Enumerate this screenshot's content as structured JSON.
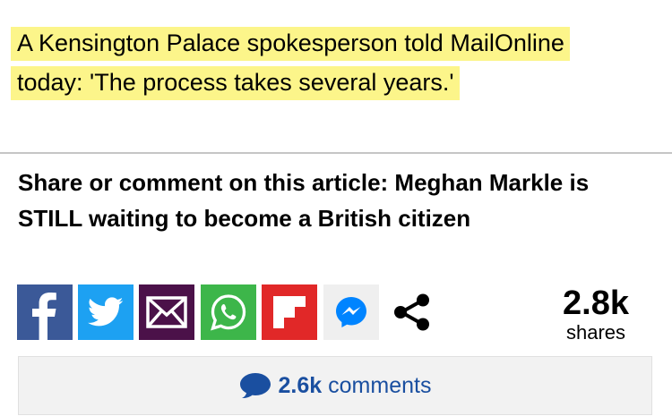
{
  "article": {
    "quote": "A Kensington Palace spokesperson told MailOnline today: 'The process takes several years.'",
    "share_title": "Share or comment on this article: Meghan Markle is STILL waiting to become a British citizen"
  },
  "share": {
    "buttons": [
      {
        "name": "facebook",
        "icon": "facebook-icon",
        "color": "#3b5998"
      },
      {
        "name": "twitter",
        "icon": "twitter-icon",
        "color": "#1da1f2"
      },
      {
        "name": "email",
        "icon": "email-icon",
        "color": "#4b1149"
      },
      {
        "name": "whatsapp",
        "icon": "whatsapp-icon",
        "color": "#3db64a"
      },
      {
        "name": "flipboard",
        "icon": "flipboard-icon",
        "color": "#e12828"
      },
      {
        "name": "messenger",
        "icon": "messenger-icon",
        "color": "#0084ff"
      },
      {
        "name": "more-share",
        "icon": "share-icon",
        "color": "#000000"
      }
    ],
    "count": "2.8k",
    "count_label": "shares"
  },
  "comments": {
    "count": "2.6k",
    "label": "comments",
    "icon": "speech-bubble-icon",
    "color": "#1a4fa0"
  },
  "colors": {
    "highlight": "#fcf58a",
    "divider": "#c6c6c6"
  }
}
